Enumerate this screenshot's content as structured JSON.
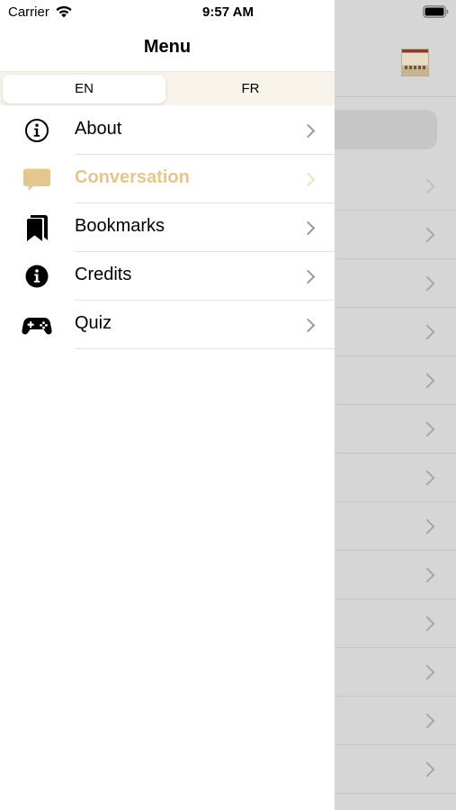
{
  "status_bar": {
    "carrier": "Carrier",
    "time": "9:57 AM",
    "wifi_icon": "wifi-icon",
    "battery_icon": "battery-icon"
  },
  "menu": {
    "title": "Menu",
    "languages": [
      {
        "label": "EN",
        "selected": true
      },
      {
        "label": "FR",
        "selected": false
      }
    ],
    "items": [
      {
        "label": "About",
        "icon": "info-circle-outline-icon",
        "selected": false
      },
      {
        "label": "Conversation",
        "icon": "speech-bubble-icon",
        "selected": true
      },
      {
        "label": "Bookmarks",
        "icon": "bookmarks-icon",
        "selected": false
      },
      {
        "label": "Credits",
        "icon": "info-circle-filled-icon",
        "selected": false
      },
      {
        "label": "Quiz",
        "icon": "gamepad-icon",
        "selected": false
      }
    ]
  },
  "colors": {
    "accent": "#e4c78d",
    "dim_overlay": "#d6d6d6",
    "segment_background": "#f8f4ec"
  }
}
